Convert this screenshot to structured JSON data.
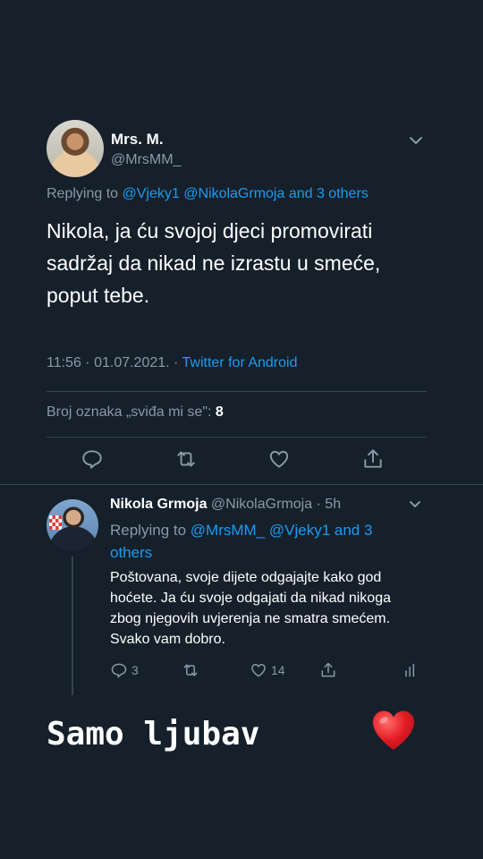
{
  "tweet": {
    "author_name": "Mrs. M.",
    "author_handle": "@MrsMM_",
    "replying_label": "Replying to ",
    "replying_targets": "@Vjeky1 @NikolaGrmoja and 3 others",
    "text": "Nikola, ja ću svojoj djeci promovirati sadržaj da nikad ne izrastu u smeće, poput tebe.",
    "time_date": "11:56 · 01.07.2021. · ",
    "client": "Twitter for Android",
    "likes_label": "Broj oznaka „sviđa mi se\": ",
    "likes_count": "8"
  },
  "reply": {
    "author_name": "Nikola Grmoja",
    "author_handle_time": " @NikolaGrmoja · 5h",
    "replying_label": "Replying to ",
    "replying_targets": "@MrsMM_ @Vjeky1 and 3 others",
    "text": "Poštovana, svoje dijete odgajajte kako god hoćete. Ja ću svoje odgajati da nikad nikoga zbog njegovih uvjerenja ne smatra smećem. Svako vam dobro.",
    "reply_count": "3",
    "like_count": "14"
  },
  "caption": "Samo ljubav",
  "colors": {
    "background": "#15202b",
    "accent": "#1d9bf0",
    "muted": "#8899a6",
    "heart": "#e0245e"
  }
}
